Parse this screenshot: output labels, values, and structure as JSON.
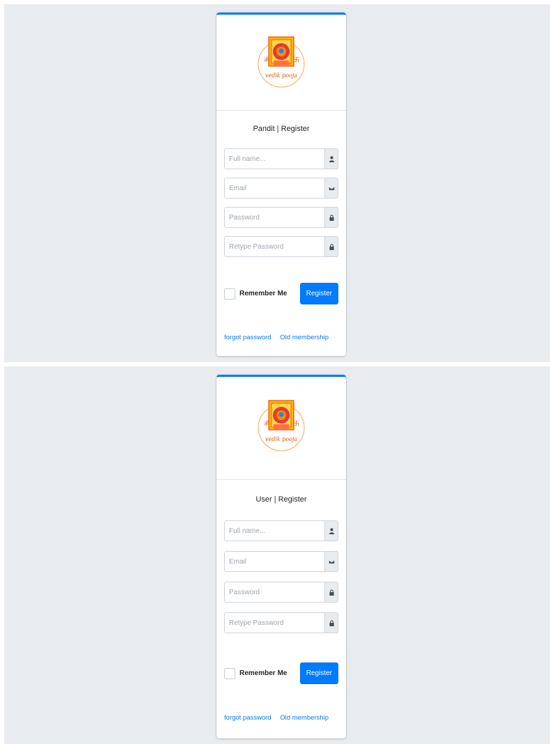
{
  "logo": {
    "om": "ॐ",
    "brand": "vedik pooja",
    "swastika": "卐"
  },
  "forms": [
    {
      "title": "Pandit | Register",
      "full_name_placeholder": "Full name...",
      "email_placeholder": "Email",
      "password_placeholder": "Password",
      "retype_password_placeholder": "Retype Password",
      "remember_label": "Remember Me",
      "register_label": "Register",
      "forgot_link": "forgot password",
      "old_membership_link": "Old membership"
    },
    {
      "title": "User | Register",
      "full_name_placeholder": "Full name...",
      "email_placeholder": "Email",
      "password_placeholder": "Password",
      "retype_password_placeholder": "Retype Password",
      "remember_label": "Remember Me",
      "register_label": "Register",
      "forgot_link": "forgot password",
      "old_membership_link": "Old membership"
    }
  ],
  "icons": [
    "user-icon",
    "envelope-icon",
    "lock-icon",
    "lock-icon"
  ],
  "colors": {
    "primary": "#007bff",
    "page_bg": "#e9ecef",
    "logo_orange": "#f57c00",
    "logo_yellow": "#ffc107",
    "logo_red": "#d32f2f"
  }
}
